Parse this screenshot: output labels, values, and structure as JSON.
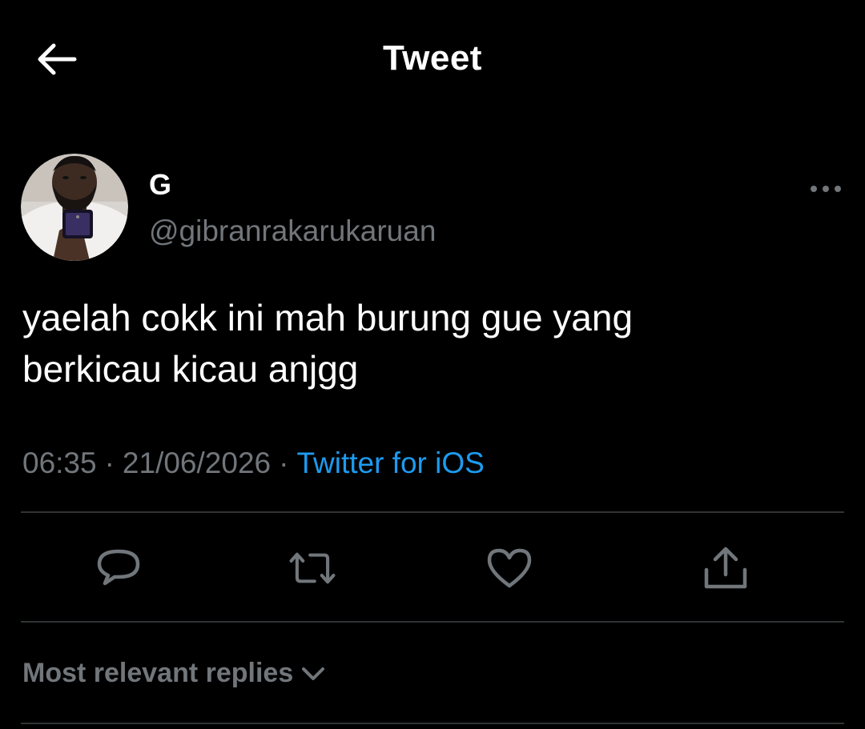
{
  "header": {
    "title": "Tweet",
    "back_icon": "arrow-left-icon"
  },
  "author": {
    "display_name": "G",
    "handle": "@gibranrakarukaruan",
    "avatar_icon": "user-avatar-photo"
  },
  "tweet": {
    "text_line_1": "yaelah cokk ini mah burung gue yang",
    "text_line_2": "berkicau kicau anjgg",
    "time": "06:35",
    "date": "21/06/2026",
    "separator": "·",
    "source": "Twitter for iOS"
  },
  "actions": {
    "reply_icon": "reply-icon",
    "retweet_icon": "retweet-icon",
    "like_icon": "heart-icon",
    "share_icon": "share-icon"
  },
  "replies": {
    "sort_label": "Most relevant replies"
  },
  "colors": {
    "background": "#000000",
    "text_primary": "#ffffff",
    "text_secondary": "#71767b",
    "accent": "#1d9bf0",
    "divider": "#2f3336"
  }
}
